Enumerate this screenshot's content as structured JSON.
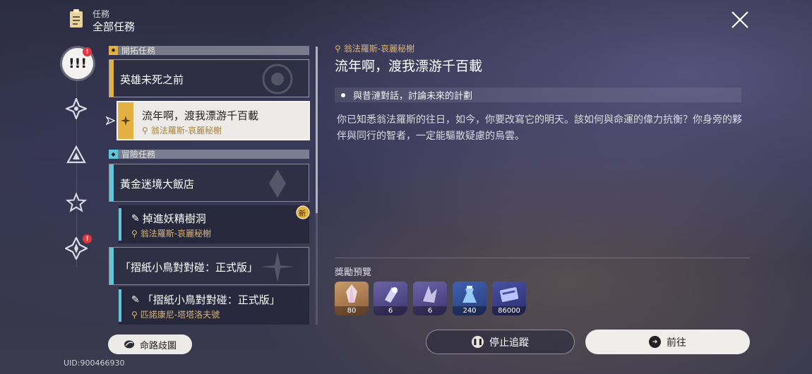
{
  "header": {
    "subtitle": "任務",
    "title": "全部任務"
  },
  "rail": {
    "active_badge": "!",
    "bottom_badge": "!",
    "active_glyph": "!!!"
  },
  "sections": [
    {
      "label": "開拓任務",
      "color": "#e3b142"
    },
    {
      "label": "冒險任務",
      "color": "#5fc6dc"
    }
  ],
  "quests": {
    "trailblaze_main": {
      "label": "英雄未死之前"
    },
    "trailblaze_selected": {
      "label": "流年啊，渡我漂游千百載",
      "location": "翁法羅斯-哀麗秘榭"
    },
    "adventure_main_1": {
      "label": "黃金迷境大飯店"
    },
    "adventure_sub_1": {
      "label": "掉進妖精樹洞",
      "location": "翁法羅斯-哀麗秘榭",
      "badge": "新"
    },
    "adventure_main_2": {
      "label": "「摺紙小鳥對對碰：正式版」"
    },
    "adventure_sub_2": {
      "label": "「摺紙小鳥對對碰：正式版」",
      "location": "匹諾康尼-塔塔洛夫號"
    }
  },
  "route_button": {
    "label": "命路歧圖"
  },
  "uid": "UID:900466930",
  "detail": {
    "location": "翁法羅斯-哀麗秘榭",
    "title": "流年啊，渡我漂游千百載",
    "objective": "與昔漣對話，討論未來的計劃",
    "description": "你已知悉翁法羅斯的往日，如今，你要改寫它的明天。該如何與命運的偉力抗衡？你身旁的夥伴與同行的智者，一定能驅散疑慮的烏雲。",
    "rewards_label": "獎勵預覽",
    "rewards": [
      {
        "icon": "crystal-icon",
        "count": "80"
      },
      {
        "icon": "purple-material-icon",
        "count": "6"
      },
      {
        "icon": "purple-shard-icon",
        "count": "6"
      },
      {
        "icon": "blue-potion-icon",
        "count": "240"
      },
      {
        "icon": "credit-icon",
        "count": "86000"
      }
    ]
  },
  "buttons": {
    "stop": "停止追蹤",
    "go": "前往"
  },
  "colors": {
    "gold": "#e3b142",
    "cyan": "#5fc6dc",
    "location": "#d9b579",
    "badge_red": "#e0383e"
  }
}
